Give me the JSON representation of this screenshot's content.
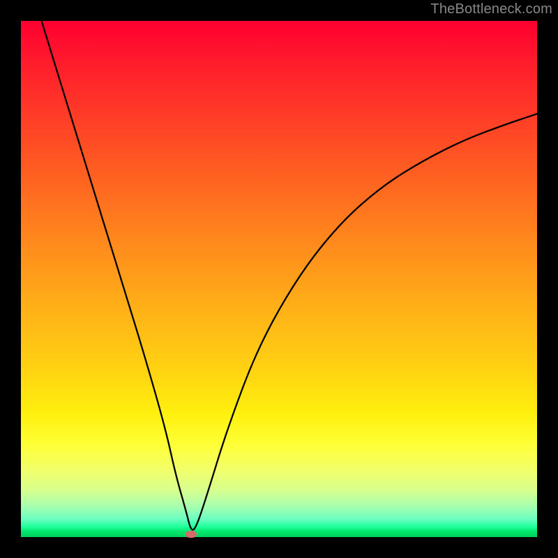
{
  "watermark": "TheBottleneck.com",
  "chart_data": {
    "type": "line",
    "title": "",
    "xlabel": "",
    "ylabel": "",
    "xlim": [
      0,
      100
    ],
    "ylim": [
      0,
      100
    ],
    "grid": false,
    "legend": false,
    "background_gradient": {
      "top": "#ff0030",
      "middle": "#ffd412",
      "bottom": "#00d05a"
    },
    "series": [
      {
        "name": "bottleneck-curve",
        "color": "#000000",
        "x": [
          4,
          8,
          12,
          16,
          20,
          24,
          28,
          30,
          32,
          33,
          34,
          36,
          40,
          46,
          54,
          62,
          70,
          78,
          86,
          94,
          100
        ],
        "values": [
          100,
          87,
          74,
          61,
          48,
          35,
          21,
          12,
          5,
          1,
          2,
          8,
          21,
          37,
          51,
          61,
          68,
          73,
          77,
          80,
          82
        ]
      }
    ],
    "marker": {
      "x": 33,
      "y": 0.5,
      "color": "#d46a6a"
    }
  }
}
